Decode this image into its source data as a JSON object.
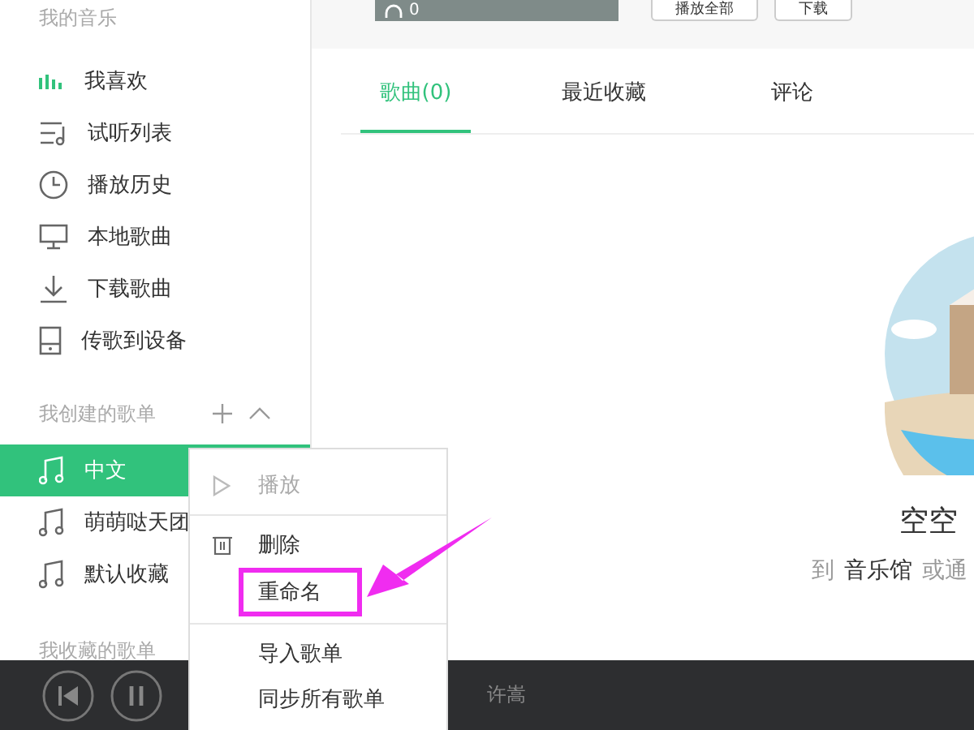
{
  "sidebar": {
    "sections": [
      {
        "title": "我的音乐",
        "has_actions": false,
        "items": [
          {
            "label": "我喜欢",
            "kind": "bars",
            "selected": false
          },
          {
            "label": "试听列表",
            "kind": "playlist",
            "selected": false
          },
          {
            "label": "播放历史",
            "kind": "clock",
            "selected": false
          },
          {
            "label": "本地歌曲",
            "kind": "monitor",
            "selected": false
          },
          {
            "label": "下载歌曲",
            "kind": "download",
            "selected": false
          },
          {
            "label": "传歌到设备",
            "kind": "device",
            "selected": false
          }
        ]
      },
      {
        "title": "我创建的歌单",
        "has_actions": true,
        "items": [
          {
            "label": "中文",
            "kind": "note",
            "selected": true
          },
          {
            "label": "萌萌哒天团",
            "kind": "note",
            "selected": false
          },
          {
            "label": "默认收藏",
            "kind": "note",
            "selected": false
          }
        ]
      },
      {
        "title": "我收藏的歌单"
      }
    ]
  },
  "header": {
    "listen_count": "0",
    "buttons": [
      "播放全部",
      "下载"
    ]
  },
  "tabs": [
    {
      "label": "歌曲(0)",
      "selected": true
    },
    {
      "label": "最近收藏",
      "selected": false
    },
    {
      "label": "评论",
      "selected": false
    }
  ],
  "empty_state": {
    "title": "空空",
    "hint": [
      {
        "kind": "text",
        "text": "到"
      },
      {
        "kind": "link",
        "text": "音乐馆"
      },
      {
        "kind": "text",
        "text": "或通"
      }
    ]
  },
  "player": {
    "artist": "许嵩"
  },
  "context_menu": {
    "items": [
      {
        "label": "播放",
        "kind": "play",
        "disabled": true,
        "divider_before": false,
        "highlighted": false
      },
      {
        "label": "删除",
        "kind": "trash",
        "disabled": false,
        "divider_before": true,
        "highlighted": false
      },
      {
        "label": "重命名",
        "kind": "plain",
        "disabled": false,
        "divider_before": false,
        "highlighted": true
      },
      {
        "label": "导入歌单",
        "kind": "plain",
        "disabled": false,
        "divider_before": true,
        "highlighted": false
      },
      {
        "label": "同步所有歌单",
        "kind": "plain",
        "disabled": false,
        "divider_before": false,
        "highlighted": false
      }
    ]
  }
}
